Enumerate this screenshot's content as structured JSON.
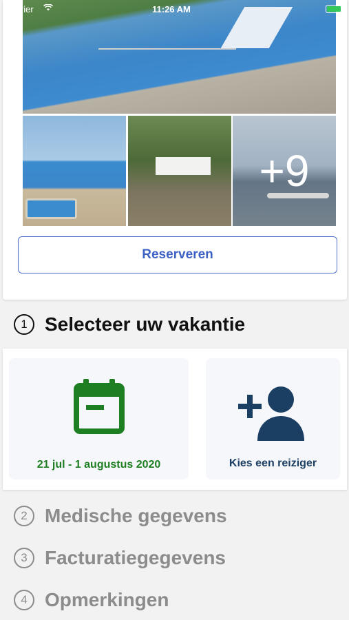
{
  "status_bar": {
    "carrier": "Carrier",
    "time": "11:26 AM",
    "wifi_icon": "wifi-icon",
    "battery_icon": "battery-charging-icon"
  },
  "gallery": {
    "photos": [
      {
        "name": "photo-pool-slides"
      },
      {
        "name": "photo-outdoor-pool"
      },
      {
        "name": "photo-campsite-tents"
      },
      {
        "name": "photo-lake-paddleboard"
      }
    ],
    "more_count_label": "+9"
  },
  "reserve": {
    "label": "Reserveren"
  },
  "steps": {
    "step1": {
      "number": "1",
      "label": "Selecteer uw vakantie"
    },
    "step2": {
      "number": "2",
      "label": "Medische gegevens"
    },
    "step3": {
      "number": "3",
      "label": "Facturatiegegevens"
    },
    "step4": {
      "number": "4",
      "label": "Opmerkingen"
    }
  },
  "selection": {
    "date": {
      "label": "21 jul - 1 augustus 2020",
      "icon": "calendar-icon",
      "color": "#1d7f22"
    },
    "traveler": {
      "label": "Kies een reiziger",
      "icon": "add-user-icon",
      "color": "#1b3e63"
    }
  },
  "colors": {
    "accent": "#3d62c4",
    "date_green": "#1d7f22",
    "traveler_navy": "#1b3e63",
    "inactive_gray": "#8c8c8c"
  }
}
